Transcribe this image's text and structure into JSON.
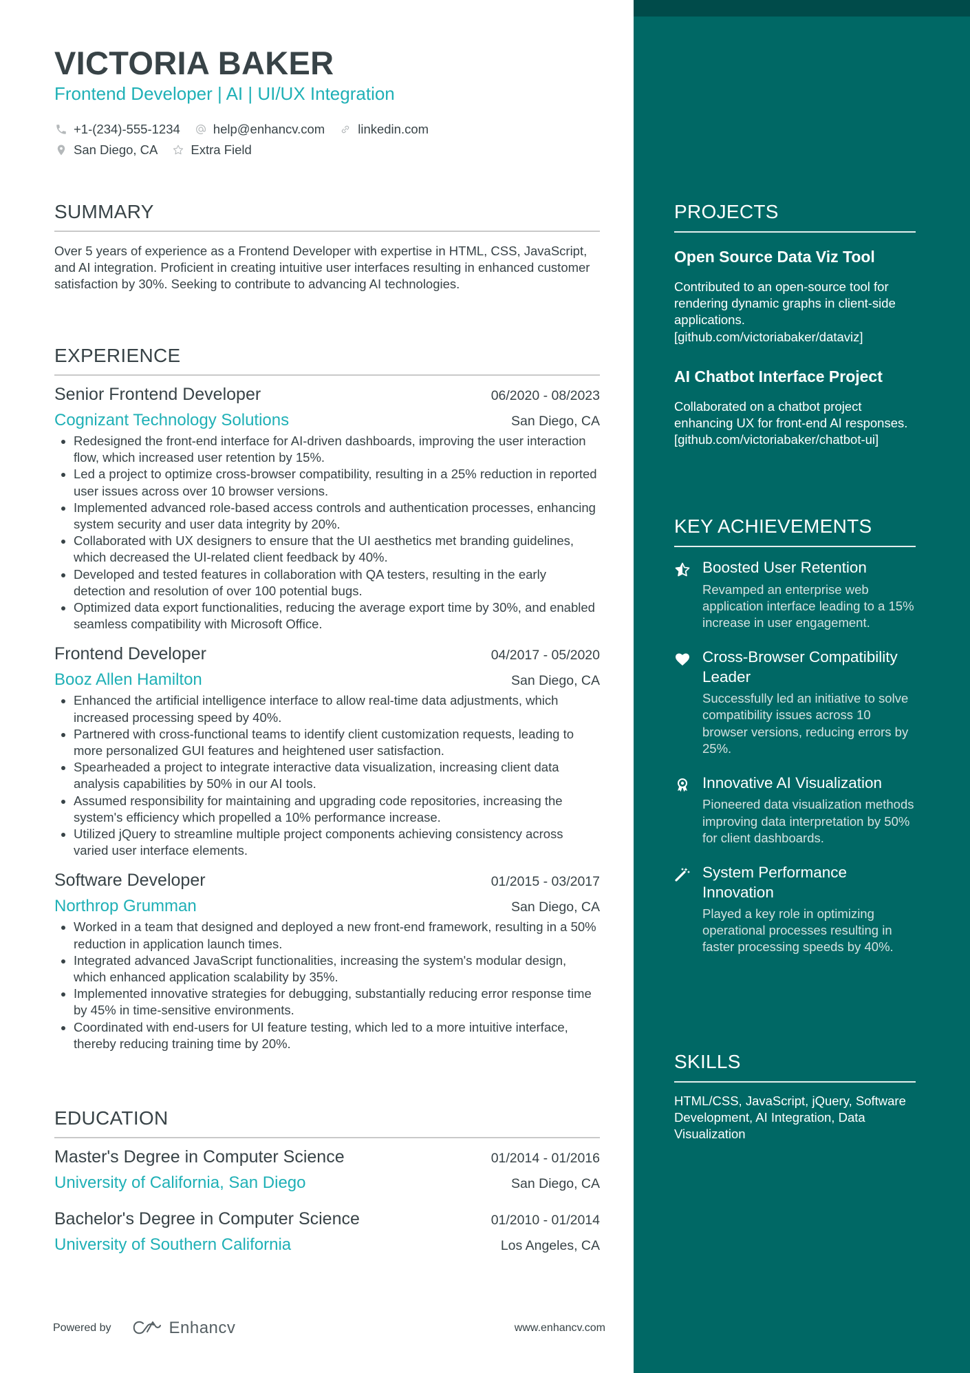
{
  "header": {
    "name": "VICTORIA BAKER",
    "subtitle": "Frontend Developer | AI | UI/UX Integration",
    "contacts": [
      {
        "icon": "phone-icon",
        "text": "+1-(234)-555-1234"
      },
      {
        "icon": "at-icon",
        "text": "help@enhancv.com"
      },
      {
        "icon": "link-icon",
        "text": "linkedin.com"
      },
      {
        "icon": "location-pin-icon",
        "text": "San Diego, CA"
      },
      {
        "icon": "star-outline-icon",
        "text": "Extra Field"
      }
    ]
  },
  "summary": {
    "title": "SUMMARY",
    "text": "Over 5 years of experience as a Frontend Developer with expertise in HTML, CSS, JavaScript, and AI integration. Proficient in creating intuitive user interfaces resulting in enhanced customer satisfaction by 30%. Seeking to contribute to advancing AI technologies."
  },
  "experience": {
    "title": "EXPERIENCE",
    "jobs": [
      {
        "title": "Senior Frontend Developer",
        "dates": "06/2020 - 08/2023",
        "company": "Cognizant Technology Solutions",
        "location": "San Diego, CA",
        "bullets": [
          "Redesigned the front-end interface for AI-driven dashboards, improving the user interaction flow, which increased user retention by 15%.",
          "Led a project to optimize cross-browser compatibility, resulting in a 25% reduction in reported user issues across over 10 browser versions.",
          "Implemented advanced role-based access controls and authentication processes, enhancing system security and user data integrity by 20%.",
          "Collaborated with UX designers to ensure that the UI aesthetics met branding guidelines, which decreased the UI-related client feedback by 40%.",
          "Developed and tested features in collaboration with QA testers, resulting in the early detection and resolution of over 100 potential bugs.",
          "Optimized data export functionalities, reducing the average export time by 30%, and enabled seamless compatibility with Microsoft Office."
        ]
      },
      {
        "title": "Frontend Developer",
        "dates": "04/2017 - 05/2020",
        "company": "Booz Allen Hamilton",
        "location": "San Diego, CA",
        "bullets": [
          "Enhanced the artificial intelligence interface to allow real-time data adjustments, which increased processing speed by 40%.",
          "Partnered with cross-functional teams to identify client customization requests, leading to more personalized GUI features and heightened user satisfaction.",
          "Spearheaded a project to integrate interactive data visualization, increasing client data analysis capabilities by 50% in our AI tools.",
          "Assumed responsibility for maintaining and upgrading code repositories, increasing the system's efficiency which propelled a 10% performance increase.",
          "Utilized jQuery to streamline multiple project components achieving consistency across varied user interface elements."
        ]
      },
      {
        "title": "Software Developer",
        "dates": "01/2015 - 03/2017",
        "company": "Northrop Grumman",
        "location": "San Diego, CA",
        "bullets": [
          "Worked in a team that designed and deployed a new front-end framework, resulting in a 50% reduction in application launch times.",
          "Integrated advanced JavaScript functionalities, increasing the system's modular design, which enhanced application scalability by 35%.",
          "Implemented innovative strategies for debugging, substantially reducing error response time by 45% in time-sensitive environments.",
          "Coordinated with end-users for UI feature testing, which led to a more intuitive interface, thereby reducing training time by 20%."
        ]
      }
    ]
  },
  "education": {
    "title": "EDUCATION",
    "items": [
      {
        "degree": "Master's Degree in Computer Science",
        "dates": "01/2014 - 01/2016",
        "school": "University of California, San Diego",
        "location": "San Diego, CA"
      },
      {
        "degree": "Bachelor's Degree in Computer Science",
        "dates": "01/2010 - 01/2014",
        "school": "University of Southern California",
        "location": "Los Angeles, CA"
      }
    ]
  },
  "footer": {
    "powered_by": "Powered by",
    "brand": "Enhancv",
    "website": "www.enhancv.com"
  },
  "sidebar": {
    "projects": {
      "title": "PROJECTS",
      "items": [
        {
          "title": "Open Source Data Viz Tool",
          "description": "Contributed to an open-source tool for rendering dynamic graphs in client-side applications. [github.com/victoriabaker/dataviz]"
        },
        {
          "title": "AI Chatbot Interface Project",
          "description": "Collaborated on a chatbot project enhancing UX for front-end AI responses. [github.com/victoriabaker/chatbot-ui]"
        }
      ]
    },
    "achievements": {
      "title": "KEY ACHIEVEMENTS",
      "items": [
        {
          "icon": "half-star-icon",
          "title": "Boosted User Retention",
          "description": "Revamped an enterprise web application interface leading to a 15% increase in user engagement."
        },
        {
          "icon": "heart-icon",
          "title": "Cross-Browser Compatibility Leader",
          "description": "Successfully led an initiative to solve compatibility issues across 10 browser versions, reducing errors by 25%."
        },
        {
          "icon": "award-medal-icon",
          "title": "Innovative AI Visualization",
          "description": "Pioneered data visualization methods improving data interpretation by 50% for client dashboards."
        },
        {
          "icon": "magic-wand-icon",
          "title": "System Performance Innovation",
          "description": "Played a key role in optimizing operational processes resulting in faster processing speeds by 40%."
        }
      ]
    },
    "skills": {
      "title": "SKILLS",
      "text": "HTML/CSS, JavaScript, jQuery, Software Development, AI Integration, Data Visualization"
    }
  },
  "colors": {
    "accent": "#1fb0b6",
    "text": "#384347",
    "sidebar": "#006865",
    "sidebar_band": "#004b4a"
  }
}
